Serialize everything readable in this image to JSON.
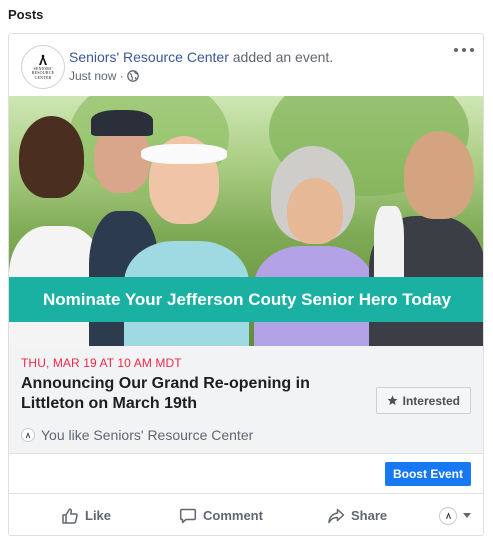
{
  "section": {
    "title": "Posts"
  },
  "post": {
    "page_name": "Seniors' Resource Center",
    "action_text": " added an event.",
    "time": "Just now ·",
    "avatar_text": "SENIORS' RESOURCE CENTER",
    "privacy_icon": "globe-icon",
    "more_icon": "more-dots-icon"
  },
  "hero": {
    "banner_text": "Nominate Your Jefferson Couty Senior Hero Today",
    "banner_color": "#1ab0a2"
  },
  "event": {
    "date": "THU, MAR 19 AT 10 AM MDT",
    "title": "Announcing Our Grand Re-opening in Littleton on March 19th",
    "interested_label": "Interested",
    "interested_icon": "star-icon",
    "like_text": "You like Seniors' Resource Center"
  },
  "boost": {
    "label": "Boost Event",
    "color": "#1877f2"
  },
  "actions": {
    "like_label": "Like",
    "comment_label": "Comment",
    "share_label": "Share"
  }
}
